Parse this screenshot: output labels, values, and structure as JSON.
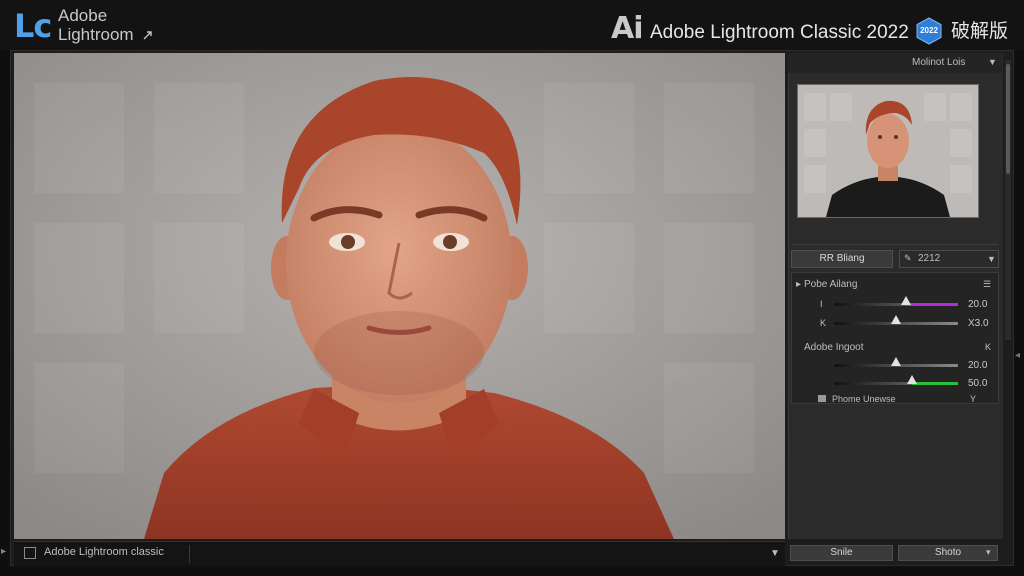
{
  "header": {
    "app_logo": "Lc",
    "brand_line1": "Adobe",
    "brand_line2": "Lightroom",
    "brand_icon": "external-link-icon",
    "ai_logo": "Ai",
    "product_title": "Adobe Lightroom Classic 2022",
    "version_badge": "2022",
    "edition_label": "破解版"
  },
  "right_panel": {
    "header_label": "Molinot Lois",
    "preset_button": "RR Bliang",
    "preset_select_value": "2212",
    "section1": {
      "title": "Pobe Ailang",
      "sliders": [
        {
          "label": "I",
          "value": "20.0",
          "fraction": 0.58
        },
        {
          "label": "K",
          "value": "X3.0",
          "fraction": 0.5
        }
      ]
    },
    "section2": {
      "title": "Adobe Ingoot",
      "corner": "K",
      "sliders": [
        {
          "value": "20.0",
          "fraction": 0.5
        },
        {
          "value": "50.0",
          "fraction": 0.63
        }
      ]
    },
    "section3_label": "Phome Unewse",
    "section3_corner": "Y",
    "bottom_button_left": "Snile",
    "bottom_button_right": "Shoto"
  },
  "filmstrip": {
    "label": "Adobe Lightroom classic"
  },
  "colors": {
    "lc_blue": "#4fa2e8",
    "slider_purple": "#b12dd6",
    "slider_green": "#27c23a"
  }
}
